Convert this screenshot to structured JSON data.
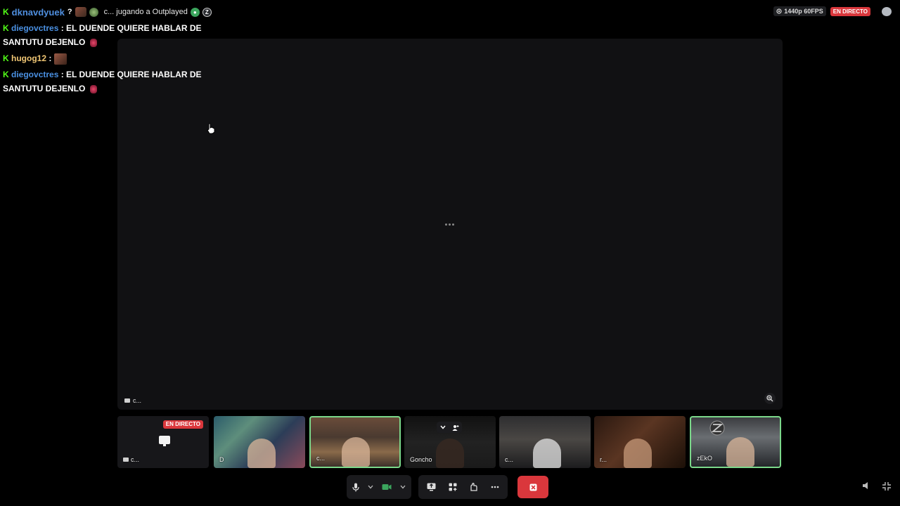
{
  "header": {
    "platform_icon": "kick-logo",
    "channel_name": "dknavdyuek",
    "channel_suffix": "?",
    "activity": "c... jugando a Outplayed",
    "stream_quality": "1440p 60FPS",
    "live_badge": "EN DIRECTO"
  },
  "chat": {
    "messages": [
      {
        "user": "diegovctres",
        "color": "#4a90e2",
        "text": ": EL DUENDE QUIERE HABLAR DE SANTUTU DEJENLO",
        "emote": true
      },
      {
        "user": "hugog12",
        "color": "#f0c674",
        "text": ":",
        "emote": false
      },
      {
        "user": "diegovctres",
        "color": "#4a90e2",
        "text": ": EL DUENDE QUIERE HABLAR DE SANTUTU DEJENLO",
        "emote": true
      }
    ]
  },
  "stage": {
    "label": "c..."
  },
  "tiles": [
    {
      "name": "c...",
      "live": "EN DIRECTO",
      "type": "screen"
    },
    {
      "name": "D"
    },
    {
      "name": "c..."
    },
    {
      "name": "Goncho"
    },
    {
      "name": "c..."
    },
    {
      "name": "r..."
    },
    {
      "name": "zEkO"
    }
  ],
  "controls": {
    "mic": "microphone-icon",
    "camera": "camera-icon",
    "share": "screen-share-icon",
    "activities": "activities-icon",
    "soundboard": "soundboard-icon",
    "more": "more-icon",
    "disconnect": "disconnect-icon"
  },
  "colors": {
    "accent_live": "#da373c",
    "kick_green": "#53fc18",
    "active_border": "#7bd88a"
  }
}
